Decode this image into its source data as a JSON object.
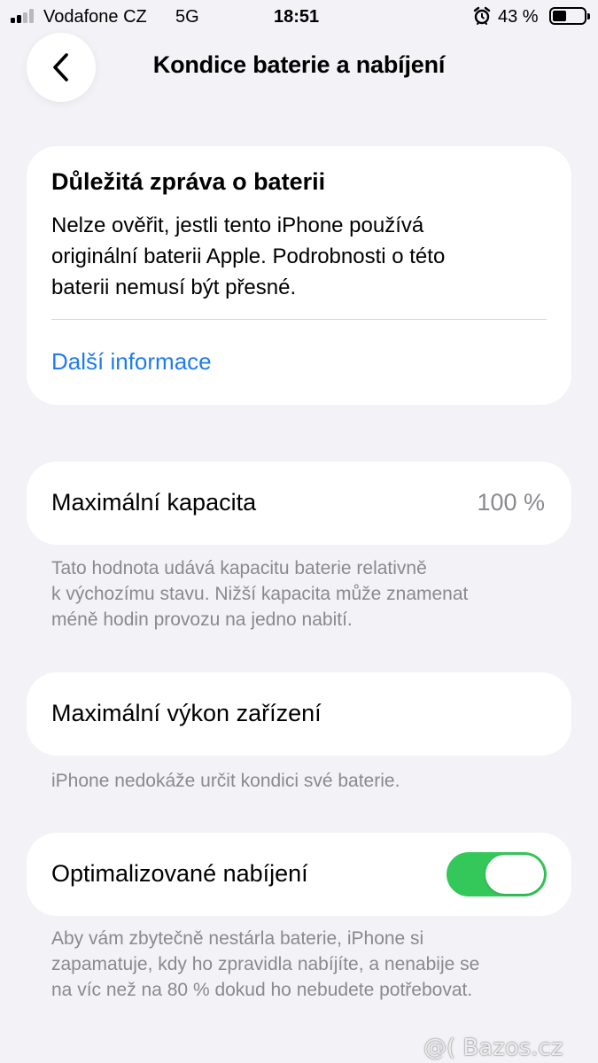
{
  "status_bar": {
    "carrier": "Vodafone CZ",
    "network": "5G",
    "time": "18:51",
    "battery_percent": "43 %",
    "icons": [
      "signal-icon",
      "alarm-icon",
      "battery-icon"
    ]
  },
  "nav": {
    "back_icon": "chevron-left-icon",
    "title": "Kondice baterie a nabíjení"
  },
  "message": {
    "title": "Důležitá zpráva o baterii",
    "body_line1": "Nelze ověřit, jestli tento iPhone používá",
    "body_line2": "originální baterii Apple. Podrobnosti o této",
    "body_line3": "baterii nemusí být přesné.",
    "link": "Další informace"
  },
  "max_capacity": {
    "label": "Maximální kapacita",
    "value": "100 %",
    "footer_line1": "Tato hodnota udává kapacitu baterie relativně",
    "footer_line2": "k výchozímu stavu. Nižší kapacita může znamenat",
    "footer_line3": "méně hodin provozu na jedno nabití."
  },
  "peak_performance": {
    "label": "Maximální výkon zařízení",
    "footer": "iPhone nedokáže určit kondici své baterie."
  },
  "optimized_charging": {
    "label": "Optimalizované nabíjení",
    "enabled": true,
    "footer_line1": "Aby vám zbytečně nestárla baterie, iPhone si",
    "footer_line2": "zapamatuje, kdy ho zpravidla nabíjíte, a nenabije se",
    "footer_line3": "na víc než na 80 % dokud ho nebudete potřebovat."
  },
  "watermark": "@( Bazos.cz",
  "colors": {
    "background": "#f2f2f7",
    "link": "#1e7cf2",
    "toggle_on": "#34c759",
    "secondary_text": "#8a8a8e"
  }
}
